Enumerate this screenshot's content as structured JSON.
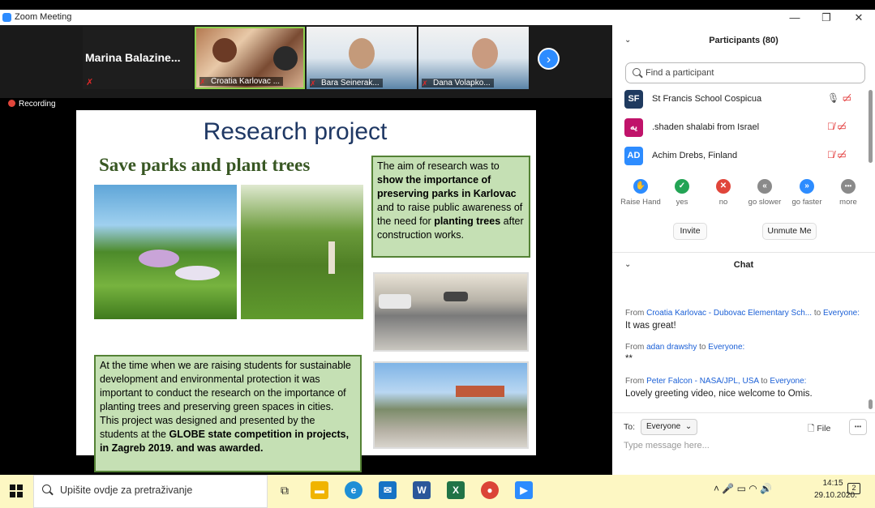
{
  "window": {
    "title": "Zoom Meeting",
    "minimize_glyph": "—",
    "restore_glyph": "❐",
    "close_glyph": "✕"
  },
  "gallery": {
    "tiles": [
      {
        "name": "Marina  Balazine...",
        "muted": true
      },
      {
        "name": "Croatia Karlovac ...",
        "muted": true
      },
      {
        "name": "Bara Seinerak...",
        "muted": true
      },
      {
        "name": "Dana Volapko...",
        "muted": true
      }
    ],
    "next_glyph": "›",
    "mic_off_glyph": "✗"
  },
  "recording": {
    "label": "Recording"
  },
  "slide": {
    "title": "Research project",
    "subtitle": "Save parks and plant trees",
    "aim": {
      "p1": "The aim of research was to ",
      "b1": "show the importance of preserving parks in Karlovac",
      "p2": " and to raise public awareness of the need for ",
      "b2": "planting trees",
      "p3": " after construction works."
    },
    "body": {
      "p1": "At the time when we are raising students for sustainable development and environmental protection it was important to conduct the research on the importance of planting trees and preserving green spaces in cities.",
      "p2": "This project was designed and presented by the students at the ",
      "b1": "GLOBE state competition in projects, in Zagreb 2019. and was awarded."
    }
  },
  "participants": {
    "header": "Participants (80)",
    "search_placeholder": "Find a participant",
    "list": [
      {
        "initials": "SF",
        "name": "St Francis School Cospicua",
        "color": "#1f3a5f",
        "mic": "on"
      },
      {
        "initials": "ﻳﻪ",
        "name": ".shaden shalabi from Israel",
        "color": "#c0136a",
        "mic": "off"
      },
      {
        "initials": "AD",
        "name": "Achim Drebs, Finland",
        "color": "#2d8cff",
        "mic": "off"
      }
    ],
    "mic_on_glyph": "🎙",
    "mic_off_glyph": "🎙̸",
    "video_off_glyph": "▭̸",
    "reactions": [
      {
        "label": "Raise Hand",
        "glyph": "✋",
        "color": "#2d8cff"
      },
      {
        "label": "yes",
        "glyph": "✓",
        "color": "#23a455"
      },
      {
        "label": "no",
        "glyph": "✕",
        "color": "#e0453a"
      },
      {
        "label": "go slower",
        "glyph": "«",
        "color": "#8a8a8a"
      },
      {
        "label": "go faster",
        "glyph": "»",
        "color": "#2d8cff"
      },
      {
        "label": "more",
        "glyph": "•••",
        "color": "#8a8a8a"
      }
    ],
    "invite_label": "Invite",
    "unmute_label": "Unmute Me"
  },
  "chat": {
    "header": "Chat",
    "messages": [
      {
        "from_label": "From ",
        "sender": "Croatia Karlovac - Dubovac Elementary Sch...",
        "to_label": " to ",
        "recipient": "Everyone:",
        "text": "It was great!"
      },
      {
        "from_label": "From ",
        "sender": "adan drawshy",
        "to_label": " to ",
        "recipient": "Everyone:",
        "text": "**"
      },
      {
        "from_label": "From ",
        "sender": "Peter Falcon - NASA/JPL, USA",
        "to_label": " to ",
        "recipient": "Everyone:",
        "text": "Lovely greeting video, nice welcome to Omis."
      }
    ],
    "to_label": "To:",
    "to_value": "Everyone",
    "file_label": "File",
    "more_glyph": "•••",
    "input_placeholder": "Type message here..."
  },
  "taskbar": {
    "search_placeholder": "Upišite ovdje za pretraživanje",
    "apps": [
      {
        "name": "task-view",
        "glyph": "⧉",
        "color": "#fdf7c3"
      },
      {
        "name": "file-explorer",
        "glyph": "▬",
        "color": "#f0b400"
      },
      {
        "name": "edge",
        "glyph": "e",
        "color": "#1e8fd6"
      },
      {
        "name": "mail",
        "glyph": "✉",
        "color": "#1673c5"
      },
      {
        "name": "word",
        "glyph": "W",
        "color": "#2b579a"
      },
      {
        "name": "excel",
        "glyph": "X",
        "color": "#217346"
      },
      {
        "name": "chrome",
        "glyph": "●",
        "color": "#db4437"
      },
      {
        "name": "zoom",
        "glyph": "▶",
        "color": "#2d8cff"
      }
    ],
    "tray_glyphs": "˄  🎤  ▭  ◠  🔊",
    "time": "14:15",
    "date": "29.10.2020.",
    "notifications": "2"
  }
}
